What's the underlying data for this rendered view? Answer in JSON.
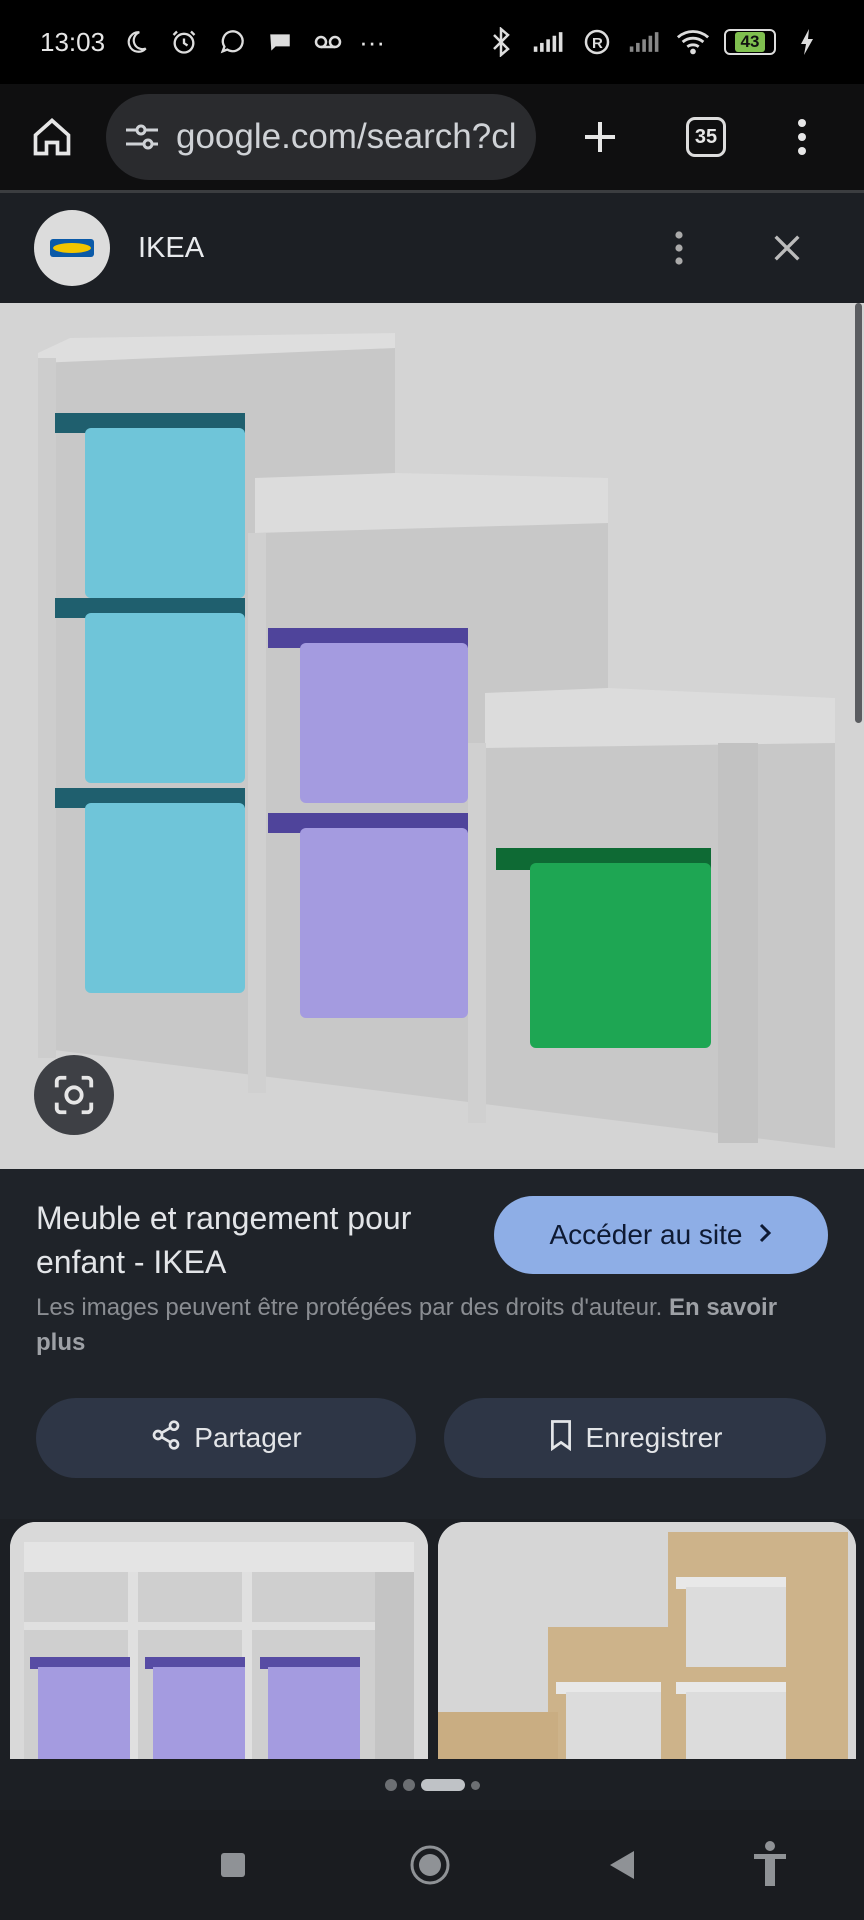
{
  "status_bar": {
    "time": "13:03",
    "more": "···",
    "battery": "43"
  },
  "browser": {
    "url": "google.com/search?client",
    "tab_count": "35"
  },
  "site": {
    "name": "IKEA"
  },
  "result": {
    "title": "Meuble et rangement pour enfant - IKEA",
    "visit_label": "Accéder au site",
    "copyright_text": "Les images peuvent être protégées par des droits d'auteur.",
    "learn_more": "En savoir plus",
    "share_label": "Partager",
    "save_label": "Enregistrer"
  },
  "colors": {
    "accent": "#8eaee6",
    "bin_blue": "#6fc5d9",
    "bin_purple": "#a49be0",
    "bin_green": "#1ea653"
  },
  "icons": [
    "home-icon",
    "site-info-icon",
    "new-tab-icon",
    "tab-switcher-icon",
    "more-vert-icon",
    "close-icon",
    "lens-icon",
    "share-icon",
    "bookmark-icon",
    "chevron-right-icon",
    "nav-recents-icon",
    "nav-home-icon",
    "nav-back-icon",
    "accessibility-icon"
  ],
  "carousel": {
    "page_count": 4,
    "active_index": 2
  }
}
